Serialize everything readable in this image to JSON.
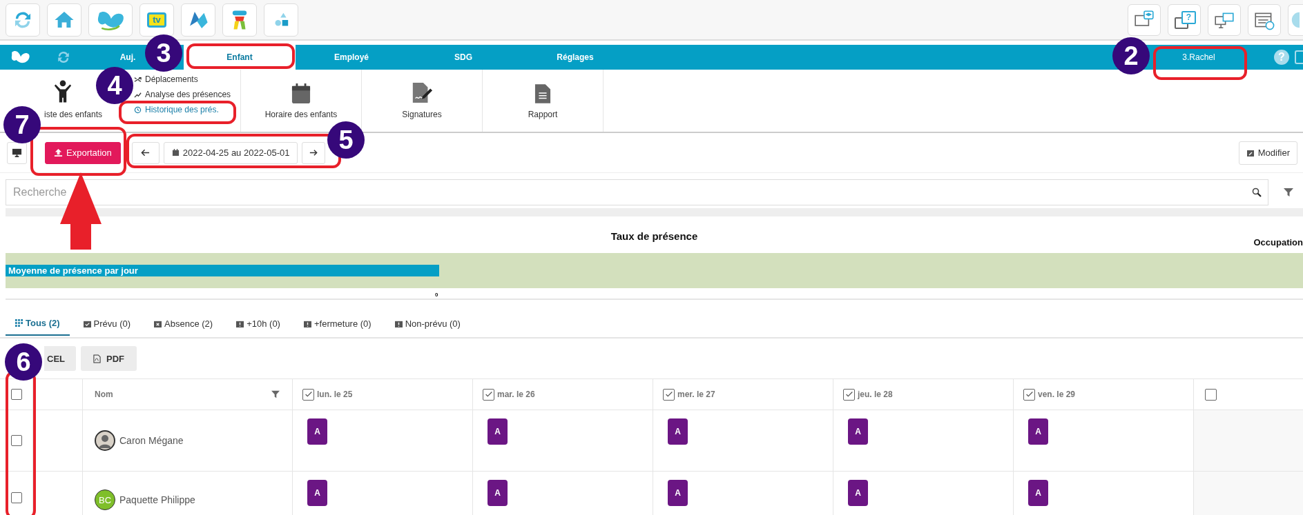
{
  "toolbar": {
    "left": [
      {
        "kind": "refresh"
      },
      {
        "kind": "home"
      },
      {
        "kind": "butterfly"
      },
      {
        "kind": "tv",
        "label": "tv"
      },
      {
        "kind": "wings"
      },
      {
        "kind": "figure"
      },
      {
        "kind": "shapes"
      }
    ],
    "right": [
      {
        "kind": "classroom"
      },
      {
        "kind": "help-chat",
        "label": "?"
      },
      {
        "kind": "monitors"
      },
      {
        "kind": "calendar"
      },
      {
        "kind": "circle"
      }
    ]
  },
  "nav": {
    "items": [
      {
        "label": "Auj.",
        "selected": false
      },
      {
        "label": "Enfant",
        "selected": true
      },
      {
        "label": "Employé",
        "selected": false
      },
      {
        "label": "SDG",
        "selected": false
      },
      {
        "label": "Réglages",
        "selected": false
      }
    ],
    "user": "3.Rachel",
    "help": "?"
  },
  "submenu": {
    "children_list": "iste des enfants",
    "links": [
      {
        "kind": "moves",
        "label": "Déplacements",
        "selected": false
      },
      {
        "kind": "analysis",
        "label": "Analyse des présences",
        "selected": false
      },
      {
        "kind": "history",
        "label": "Historique des prés.",
        "selected": true
      }
    ],
    "items": [
      {
        "kind": "calendar",
        "label": "Horaire des enfants"
      },
      {
        "kind": "signature",
        "label": "Signatures"
      },
      {
        "kind": "report",
        "label": "Rapport"
      }
    ]
  },
  "actions": {
    "export": "Exportation",
    "range": "2022-04-25 au 2022-05-01",
    "edit": "Modifier"
  },
  "search": {
    "placeholder": "Recherche"
  },
  "summary": {
    "title": "Taux de présence",
    "side_title": "Occupation",
    "bar_label": "Moyenne de présence par jour",
    "axis_label": "0"
  },
  "tabs": [
    {
      "kind": "all",
      "label": "Tous (2)",
      "selected": true
    },
    {
      "kind": "planned",
      "label": "Prévu (0)",
      "selected": false
    },
    {
      "kind": "absence",
      "label": "Absence (2)",
      "selected": false
    },
    {
      "kind": "alert",
      "label": "+10h (0)",
      "selected": false
    },
    {
      "kind": "alert",
      "label": "+fermeture (0)",
      "selected": false
    },
    {
      "kind": "alert",
      "label": "Non-prévu (0)",
      "selected": false
    }
  ],
  "exports": [
    "CEL",
    "PDF"
  ],
  "table": {
    "select_all": false,
    "name_header": "Nom",
    "days": [
      {
        "label": "lun. le 25",
        "checked": true
      },
      {
        "label": "mar. le 26",
        "checked": true
      },
      {
        "label": "mer. le 27",
        "checked": true
      },
      {
        "label": "jeu. le 28",
        "checked": true
      },
      {
        "label": "ven. le 29",
        "checked": true
      }
    ],
    "last_checked": false,
    "rows": [
      {
        "name": "Caron Mégane",
        "checked": false,
        "avatar": {
          "kind": "photo"
        },
        "cells": [
          "A",
          "A",
          "A",
          "A",
          "A"
        ]
      },
      {
        "name": "Paquette Philippe",
        "checked": false,
        "avatar": {
          "kind": "initials",
          "text": "BC"
        },
        "cells": [
          "A",
          "A",
          "A",
          "A",
          "A"
        ]
      }
    ]
  },
  "callouts": [
    "3",
    "2",
    "4",
    "7",
    "5",
    "6"
  ]
}
